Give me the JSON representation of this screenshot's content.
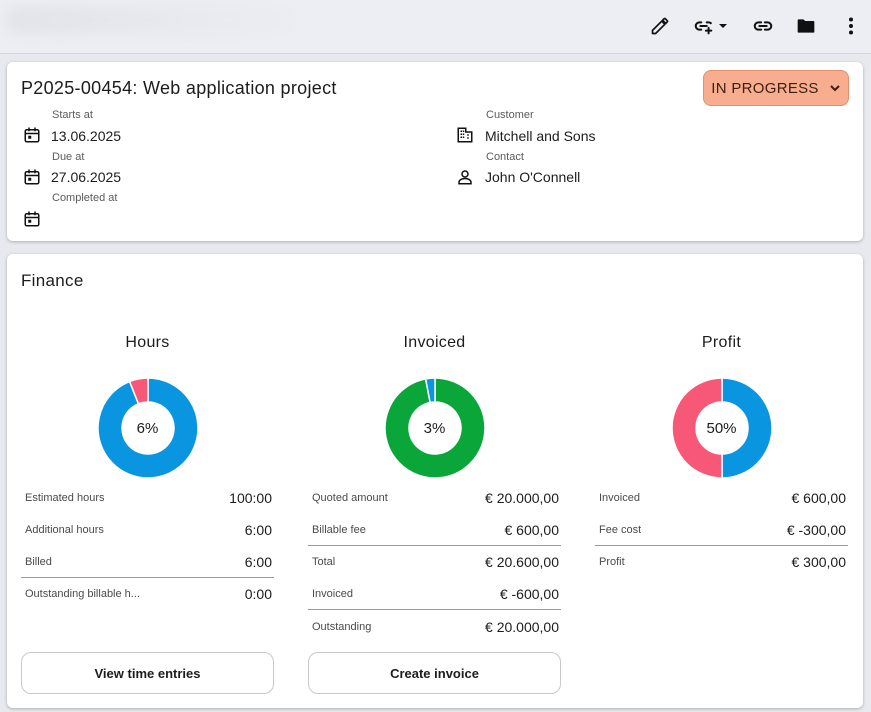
{
  "toolbar": {
    "icons": [
      "edit-icon",
      "link-add-icon",
      "chevron-down-icon",
      "link-icon",
      "folder-icon",
      "more-vert-icon"
    ]
  },
  "project": {
    "title": "P2025-00454: Web application project",
    "status": "IN PROGRESS",
    "status_color": "#f8ad8e",
    "starts_at_label": "Starts at",
    "starts_at": "13.06.2025",
    "due_at_label": "Due at",
    "due_at": "27.06.2025",
    "completed_at_label": "Completed at",
    "completed_at": "",
    "customer_label": "Customer",
    "customer": "Mitchell and Sons",
    "contact_label": "Contact",
    "contact": "John O'Connell"
  },
  "finance": {
    "title": "Finance",
    "hours": {
      "title": "Hours",
      "percent_label": "6%",
      "rows": [
        {
          "label": "Estimated hours",
          "value": "100:00"
        },
        {
          "label": "Additional hours",
          "value": "6:00"
        },
        {
          "label": "Billed",
          "value": "6:00"
        },
        {
          "label": "Outstanding billable h...",
          "value": "0:00"
        }
      ],
      "button": "View time entries"
    },
    "invoiced": {
      "title": "Invoiced",
      "percent_label": "3%",
      "rows": [
        {
          "label": "Quoted amount",
          "value": "€ 20.000,00"
        },
        {
          "label": "Billable fee",
          "value": "€ 600,00"
        },
        {
          "label": "Total",
          "value": "€ 20.600,00"
        },
        {
          "label": "Invoiced",
          "value": "€ -600,00"
        },
        {
          "label": "Outstanding",
          "value": "€ 20.000,00"
        }
      ],
      "button": "Create invoice"
    },
    "profit": {
      "title": "Profit",
      "percent_label": "50%",
      "rows": [
        {
          "label": "Invoiced",
          "value": "€ 600,00"
        },
        {
          "label": "Fee cost",
          "value": "€ -300,00"
        },
        {
          "label": "Profit",
          "value": "€ 300,00"
        }
      ]
    }
  },
  "chart_data": [
    {
      "type": "pie",
      "title": "Hours",
      "labels": [],
      "values": [
        94,
        6
      ],
      "colors": [
        "#0a95e0",
        "#f85878"
      ],
      "center_label": "6%"
    },
    {
      "type": "pie",
      "title": "Invoiced",
      "labels": [],
      "values": [
        97,
        3
      ],
      "colors": [
        "#0aa63a",
        "#0a95e0"
      ],
      "center_label": "3%"
    },
    {
      "type": "pie",
      "title": "Profit",
      "labels": [],
      "values": [
        50,
        50
      ],
      "colors": [
        "#0a95e0",
        "#f85878"
      ],
      "center_label": "50%"
    }
  ]
}
